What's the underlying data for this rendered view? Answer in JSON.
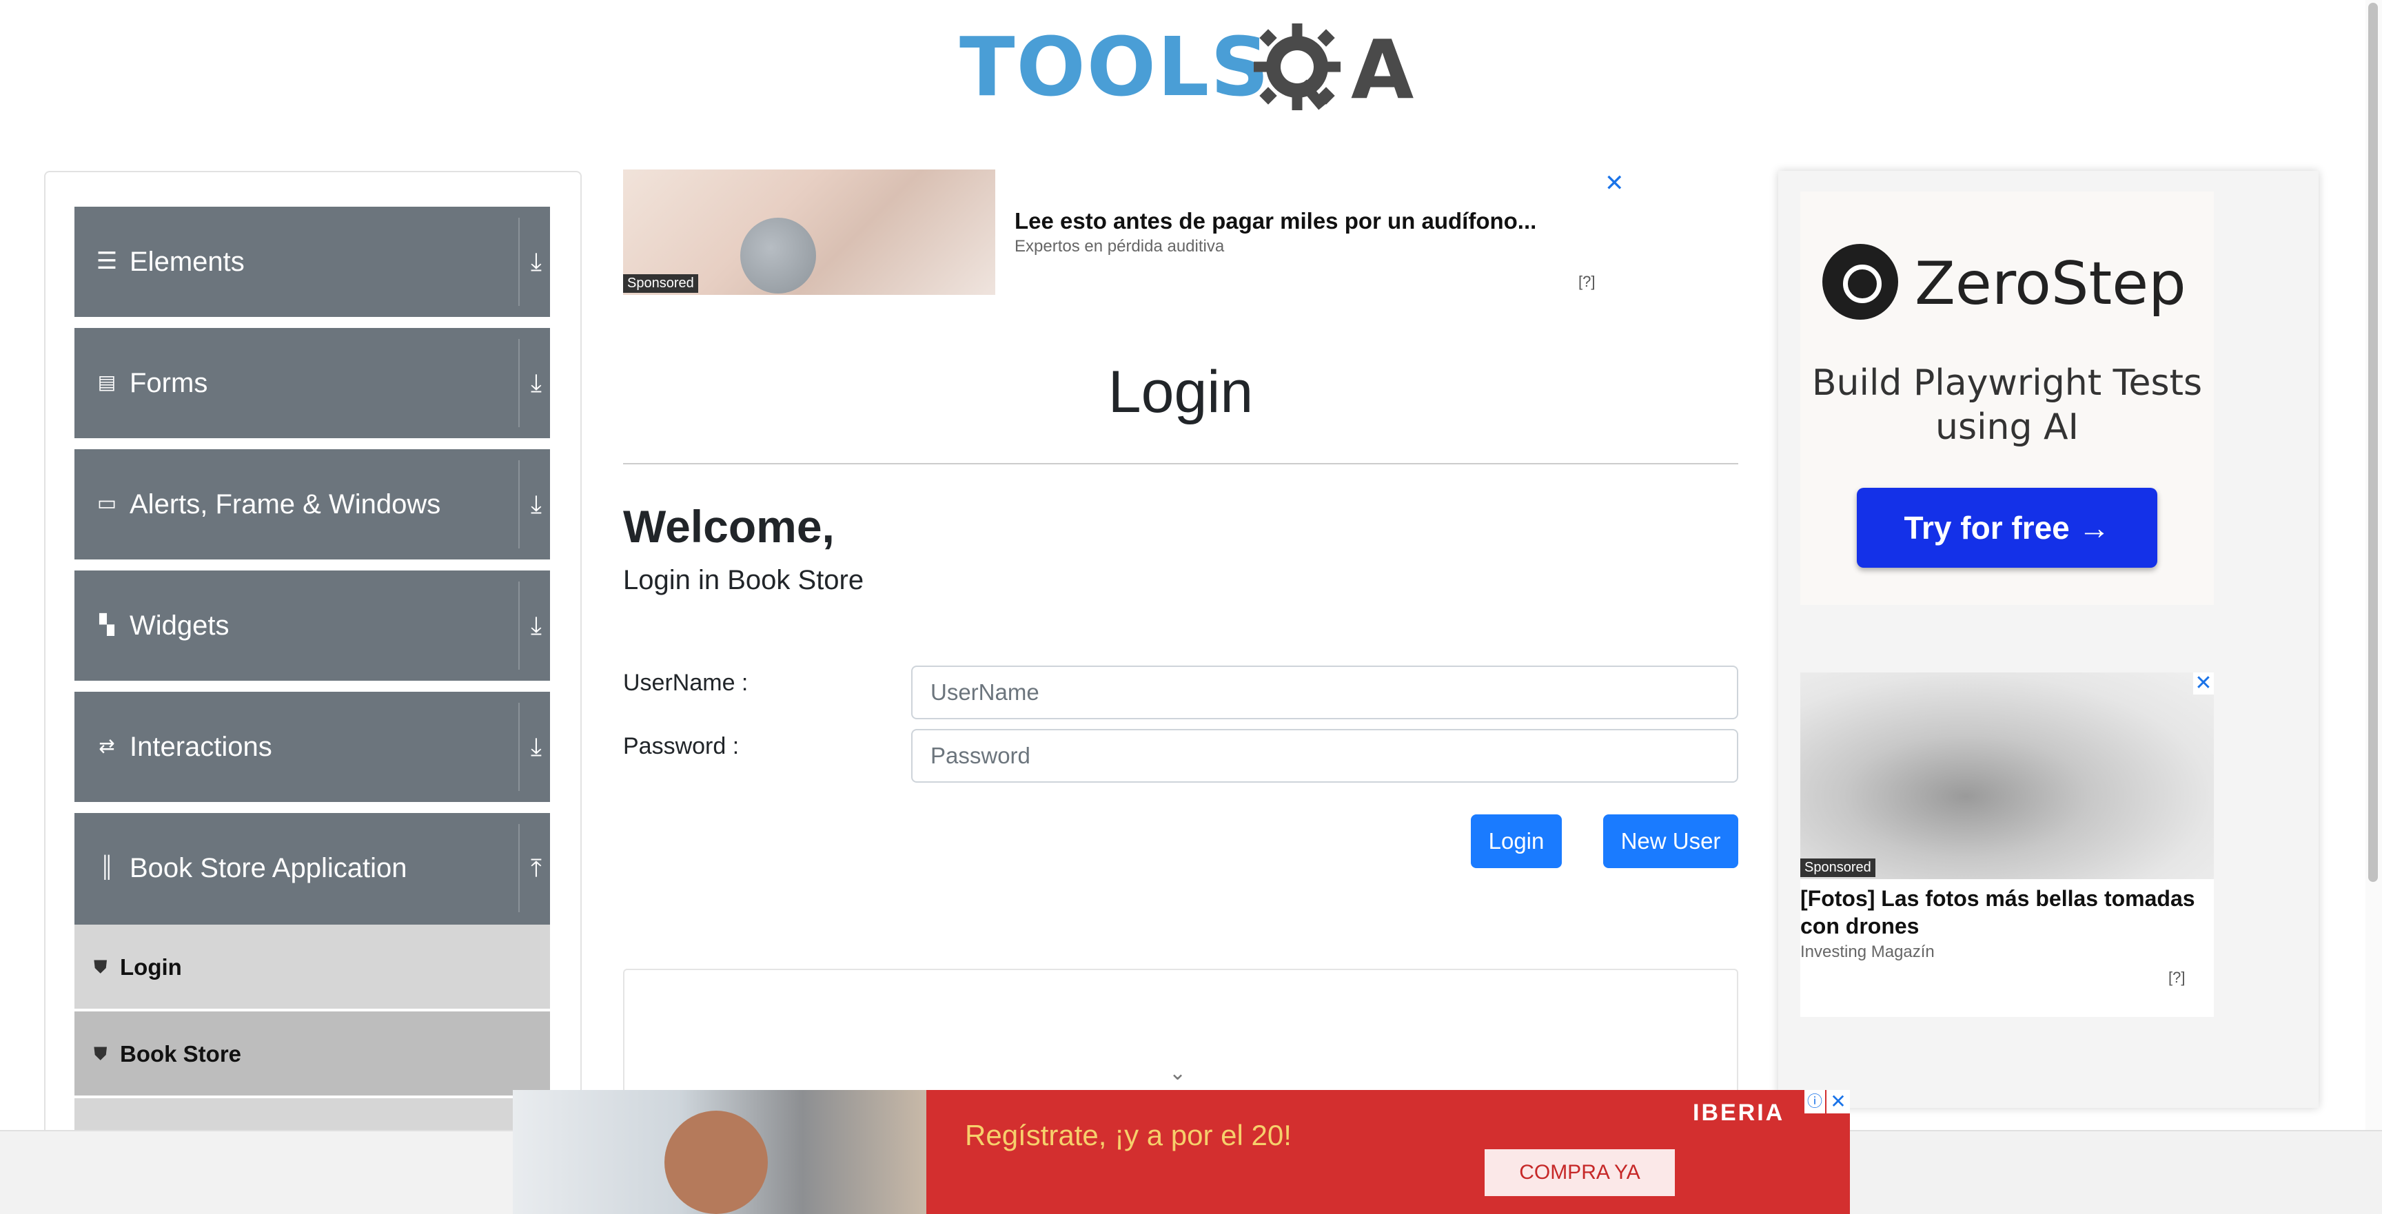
{
  "header": {
    "logo_text_primary": "TOOLS",
    "logo_text_secondary": "A"
  },
  "sidebar": {
    "groups": [
      {
        "label": "Elements",
        "icon": "hamburger-icon",
        "arrow": "⤓"
      },
      {
        "label": "Forms",
        "icon": "document-icon",
        "arrow": "⤓"
      },
      {
        "label": "Alerts, Frame & Windows",
        "icon": "window-icon",
        "arrow": "⤓"
      },
      {
        "label": "Widgets",
        "icon": "widgets-icon",
        "arrow": "⤓"
      },
      {
        "label": "Interactions",
        "icon": "interactions-icon",
        "arrow": "⤓"
      },
      {
        "label": "Book Store Application",
        "icon": "library-icon",
        "arrow": "⤒"
      }
    ],
    "subitems": [
      {
        "label": "Login",
        "icon": "html5-icon"
      },
      {
        "label": "Book Store",
        "icon": "html5-icon"
      }
    ]
  },
  "ad_top": {
    "title": "Lee esto antes de pagar miles por un audífono...",
    "subtitle": "Expertos en pérdida auditiva",
    "sponsored": "Sponsored",
    "help": "[?]",
    "close": "✕"
  },
  "main": {
    "page_title": "Login",
    "welcome": "Welcome,",
    "subtitle": "Login in Book Store",
    "username_label": "UserName :",
    "username_placeholder": "UserName",
    "password_label": "Password :",
    "password_placeholder": "Password",
    "login_button": "Login",
    "new_user_button": "New User",
    "chevron": "⌄"
  },
  "ad_right": {
    "brand": "ZeroStep",
    "tagline": "Build Playwright Tests using AI",
    "cta": "Try for free →",
    "sponsored": "Sponsored",
    "drone_title": "[Fotos] Las fotos más bellas tomadas con drones",
    "drone_source": "Investing Magazín",
    "help": "[?]",
    "close": "✕"
  },
  "ad_bottom": {
    "text": "Regístrate, ¡y a por el 20!",
    "brand": "IBERIA",
    "cta": "COMPRA YA",
    "info": "ⓘ",
    "close": "✕"
  },
  "colors": {
    "sidebar_group": "#6c757d",
    "primary_button": "#1a7bff",
    "logo_blue": "#4a9ed6",
    "zerostep_button": "#1431e8",
    "iberia_red": "#d32f2f"
  }
}
